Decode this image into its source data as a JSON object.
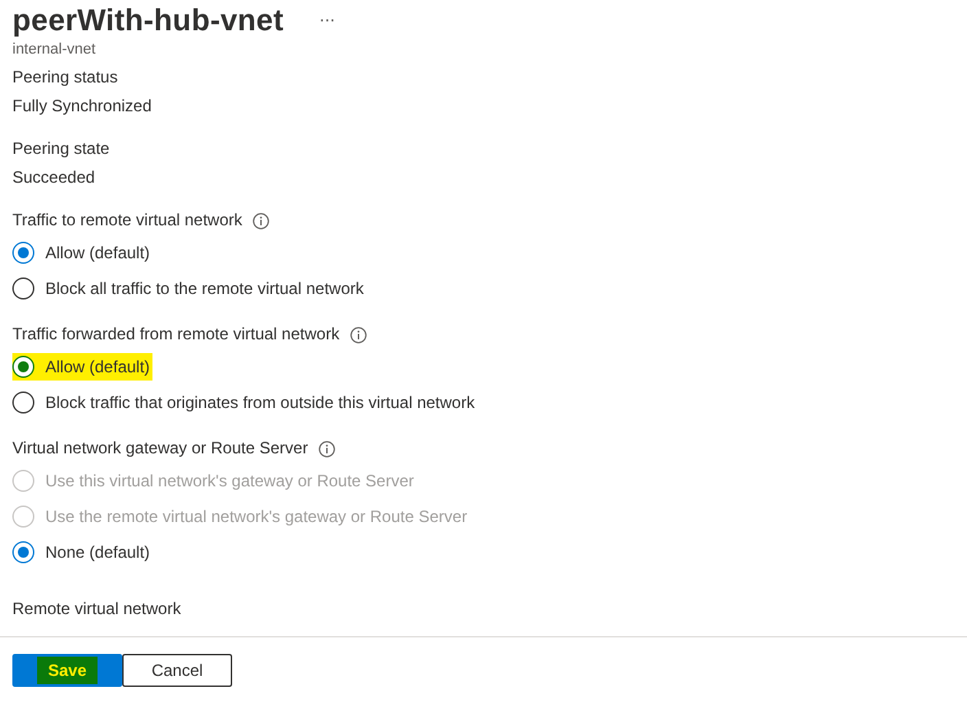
{
  "header": {
    "title": "peerWith-hub-vnet",
    "more": "···",
    "subtitle": "internal-vnet"
  },
  "fields": [
    {
      "label": "Peering status",
      "value": "Fully Synchronized"
    },
    {
      "label": "Peering state",
      "value": "Succeeded"
    }
  ],
  "groups": [
    {
      "label": "Traffic to remote virtual network",
      "options": [
        {
          "label": "Allow (default)",
          "selected": true,
          "disabled": false,
          "highlighted": false
        },
        {
          "label": "Block all traffic to the remote virtual network",
          "selected": false,
          "disabled": false,
          "highlighted": false
        }
      ]
    },
    {
      "label": "Traffic forwarded from remote virtual network",
      "options": [
        {
          "label": "Allow (default)",
          "selected": true,
          "disabled": false,
          "highlighted": true
        },
        {
          "label": "Block traffic that originates from outside this virtual network",
          "selected": false,
          "disabled": false,
          "highlighted": false
        }
      ]
    },
    {
      "label": "Virtual network gateway or Route Server",
      "options": [
        {
          "label": "Use this virtual network's gateway or Route Server",
          "selected": false,
          "disabled": true,
          "highlighted": false
        },
        {
          "label": "Use the remote virtual network's gateway or Route Server",
          "selected": false,
          "disabled": true,
          "highlighted": false
        },
        {
          "label": "None (default)",
          "selected": true,
          "disabled": false,
          "highlighted": false
        }
      ]
    }
  ],
  "section": "Remote virtual network",
  "buttons": [
    {
      "kind": "primary",
      "label": "Save",
      "highlighted": true
    },
    {
      "kind": "secondary",
      "label": "Cancel",
      "highlighted": false
    }
  ]
}
